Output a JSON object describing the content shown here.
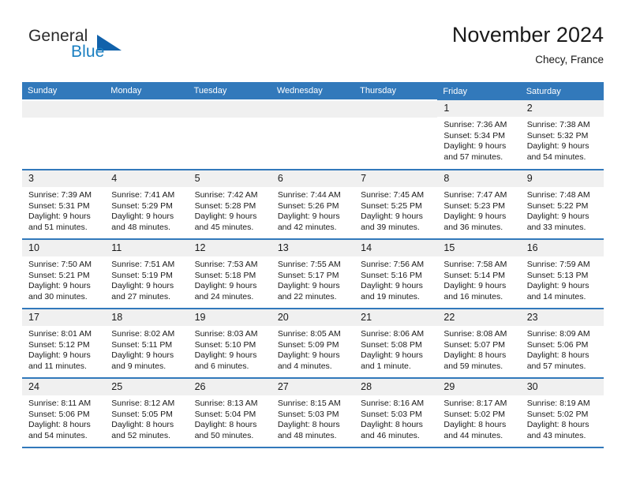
{
  "logo": {
    "word_top": "General",
    "word_bottom": "Blue",
    "triangle_color": "#1162ab",
    "blue_text_color": "#1a7fc1"
  },
  "header": {
    "title": "November 2024",
    "subtitle": "Checy, France",
    "accent_color": "#3279bb"
  },
  "weekday_headers": [
    "Sunday",
    "Monday",
    "Tuesday",
    "Wednesday",
    "Thursday",
    "Friday",
    "Saturday"
  ],
  "weeks": [
    [
      {
        "day": "",
        "lines": []
      },
      {
        "day": "",
        "lines": []
      },
      {
        "day": "",
        "lines": []
      },
      {
        "day": "",
        "lines": []
      },
      {
        "day": "",
        "lines": []
      },
      {
        "day": "1",
        "lines": [
          "Sunrise: 7:36 AM",
          "Sunset: 5:34 PM",
          "Daylight: 9 hours",
          "and 57 minutes."
        ]
      },
      {
        "day": "2",
        "lines": [
          "Sunrise: 7:38 AM",
          "Sunset: 5:32 PM",
          "Daylight: 9 hours",
          "and 54 minutes."
        ]
      }
    ],
    [
      {
        "day": "3",
        "lines": [
          "Sunrise: 7:39 AM",
          "Sunset: 5:31 PM",
          "Daylight: 9 hours",
          "and 51 minutes."
        ]
      },
      {
        "day": "4",
        "lines": [
          "Sunrise: 7:41 AM",
          "Sunset: 5:29 PM",
          "Daylight: 9 hours",
          "and 48 minutes."
        ]
      },
      {
        "day": "5",
        "lines": [
          "Sunrise: 7:42 AM",
          "Sunset: 5:28 PM",
          "Daylight: 9 hours",
          "and 45 minutes."
        ]
      },
      {
        "day": "6",
        "lines": [
          "Sunrise: 7:44 AM",
          "Sunset: 5:26 PM",
          "Daylight: 9 hours",
          "and 42 minutes."
        ]
      },
      {
        "day": "7",
        "lines": [
          "Sunrise: 7:45 AM",
          "Sunset: 5:25 PM",
          "Daylight: 9 hours",
          "and 39 minutes."
        ]
      },
      {
        "day": "8",
        "lines": [
          "Sunrise: 7:47 AM",
          "Sunset: 5:23 PM",
          "Daylight: 9 hours",
          "and 36 minutes."
        ]
      },
      {
        "day": "9",
        "lines": [
          "Sunrise: 7:48 AM",
          "Sunset: 5:22 PM",
          "Daylight: 9 hours",
          "and 33 minutes."
        ]
      }
    ],
    [
      {
        "day": "10",
        "lines": [
          "Sunrise: 7:50 AM",
          "Sunset: 5:21 PM",
          "Daylight: 9 hours",
          "and 30 minutes."
        ]
      },
      {
        "day": "11",
        "lines": [
          "Sunrise: 7:51 AM",
          "Sunset: 5:19 PM",
          "Daylight: 9 hours",
          "and 27 minutes."
        ]
      },
      {
        "day": "12",
        "lines": [
          "Sunrise: 7:53 AM",
          "Sunset: 5:18 PM",
          "Daylight: 9 hours",
          "and 24 minutes."
        ]
      },
      {
        "day": "13",
        "lines": [
          "Sunrise: 7:55 AM",
          "Sunset: 5:17 PM",
          "Daylight: 9 hours",
          "and 22 minutes."
        ]
      },
      {
        "day": "14",
        "lines": [
          "Sunrise: 7:56 AM",
          "Sunset: 5:16 PM",
          "Daylight: 9 hours",
          "and 19 minutes."
        ]
      },
      {
        "day": "15",
        "lines": [
          "Sunrise: 7:58 AM",
          "Sunset: 5:14 PM",
          "Daylight: 9 hours",
          "and 16 minutes."
        ]
      },
      {
        "day": "16",
        "lines": [
          "Sunrise: 7:59 AM",
          "Sunset: 5:13 PM",
          "Daylight: 9 hours",
          "and 14 minutes."
        ]
      }
    ],
    [
      {
        "day": "17",
        "lines": [
          "Sunrise: 8:01 AM",
          "Sunset: 5:12 PM",
          "Daylight: 9 hours",
          "and 11 minutes."
        ]
      },
      {
        "day": "18",
        "lines": [
          "Sunrise: 8:02 AM",
          "Sunset: 5:11 PM",
          "Daylight: 9 hours",
          "and 9 minutes."
        ]
      },
      {
        "day": "19",
        "lines": [
          "Sunrise: 8:03 AM",
          "Sunset: 5:10 PM",
          "Daylight: 9 hours",
          "and 6 minutes."
        ]
      },
      {
        "day": "20",
        "lines": [
          "Sunrise: 8:05 AM",
          "Sunset: 5:09 PM",
          "Daylight: 9 hours",
          "and 4 minutes."
        ]
      },
      {
        "day": "21",
        "lines": [
          "Sunrise: 8:06 AM",
          "Sunset: 5:08 PM",
          "Daylight: 9 hours",
          "and 1 minute."
        ]
      },
      {
        "day": "22",
        "lines": [
          "Sunrise: 8:08 AM",
          "Sunset: 5:07 PM",
          "Daylight: 8 hours",
          "and 59 minutes."
        ]
      },
      {
        "day": "23",
        "lines": [
          "Sunrise: 8:09 AM",
          "Sunset: 5:06 PM",
          "Daylight: 8 hours",
          "and 57 minutes."
        ]
      }
    ],
    [
      {
        "day": "24",
        "lines": [
          "Sunrise: 8:11 AM",
          "Sunset: 5:06 PM",
          "Daylight: 8 hours",
          "and 54 minutes."
        ]
      },
      {
        "day": "25",
        "lines": [
          "Sunrise: 8:12 AM",
          "Sunset: 5:05 PM",
          "Daylight: 8 hours",
          "and 52 minutes."
        ]
      },
      {
        "day": "26",
        "lines": [
          "Sunrise: 8:13 AM",
          "Sunset: 5:04 PM",
          "Daylight: 8 hours",
          "and 50 minutes."
        ]
      },
      {
        "day": "27",
        "lines": [
          "Sunrise: 8:15 AM",
          "Sunset: 5:03 PM",
          "Daylight: 8 hours",
          "and 48 minutes."
        ]
      },
      {
        "day": "28",
        "lines": [
          "Sunrise: 8:16 AM",
          "Sunset: 5:03 PM",
          "Daylight: 8 hours",
          "and 46 minutes."
        ]
      },
      {
        "day": "29",
        "lines": [
          "Sunrise: 8:17 AM",
          "Sunset: 5:02 PM",
          "Daylight: 8 hours",
          "and 44 minutes."
        ]
      },
      {
        "day": "30",
        "lines": [
          "Sunrise: 8:19 AM",
          "Sunset: 5:02 PM",
          "Daylight: 8 hours",
          "and 43 minutes."
        ]
      }
    ]
  ]
}
